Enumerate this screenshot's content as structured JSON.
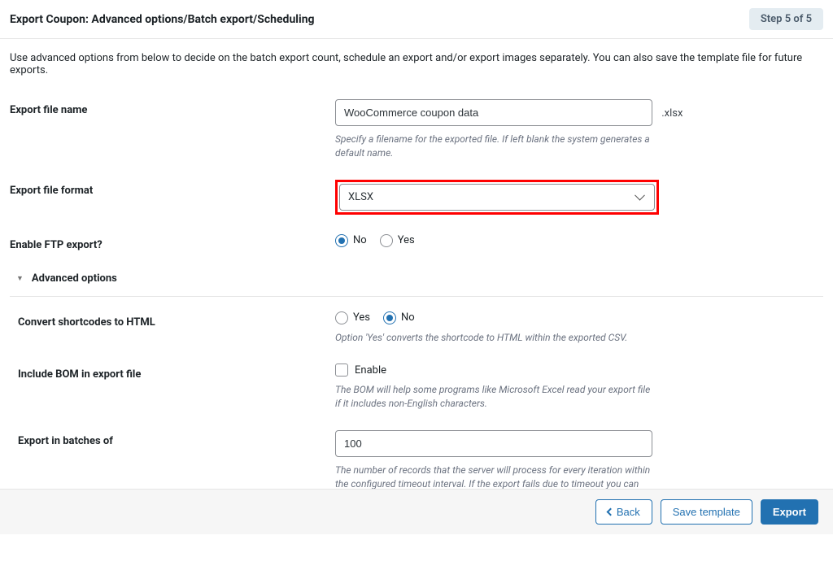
{
  "header": {
    "title": "Export Coupon: Advanced options/Batch export/Scheduling",
    "step": "Step 5 of 5"
  },
  "description": "Use advanced options from below to decide on the batch export count, schedule an export and/or export images separately. You can also save the template file for future exports.",
  "filename": {
    "label": "Export file name",
    "value": "WooCommerce coupon data",
    "ext": ".xlsx",
    "helper": "Specify a filename for the exported file. If left blank the system generates a default name."
  },
  "format": {
    "label": "Export file format",
    "value": "XLSX"
  },
  "ftp": {
    "label": "Enable FTP export?",
    "no": "No",
    "yes": "Yes"
  },
  "advanced": {
    "title": "Advanced options"
  },
  "shortcodes": {
    "label": "Convert shortcodes to HTML",
    "yes": "Yes",
    "no": "No",
    "helper": "Option 'Yes' converts the shortcode to HTML within the exported CSV."
  },
  "bom": {
    "label": "Include BOM in export file",
    "enable": "Enable",
    "helper": "The BOM will help some programs like Microsoft Excel read your export file if it includes non-English characters."
  },
  "batch": {
    "label": "Export in batches of",
    "value": "100",
    "helper": "The number of records that the server will process for every iteration within the configured timeout interval. If the export fails due to timeout you can lower this number accordingly and try again"
  },
  "footer": {
    "back": "Back",
    "save": "Save template",
    "export": "Export"
  }
}
